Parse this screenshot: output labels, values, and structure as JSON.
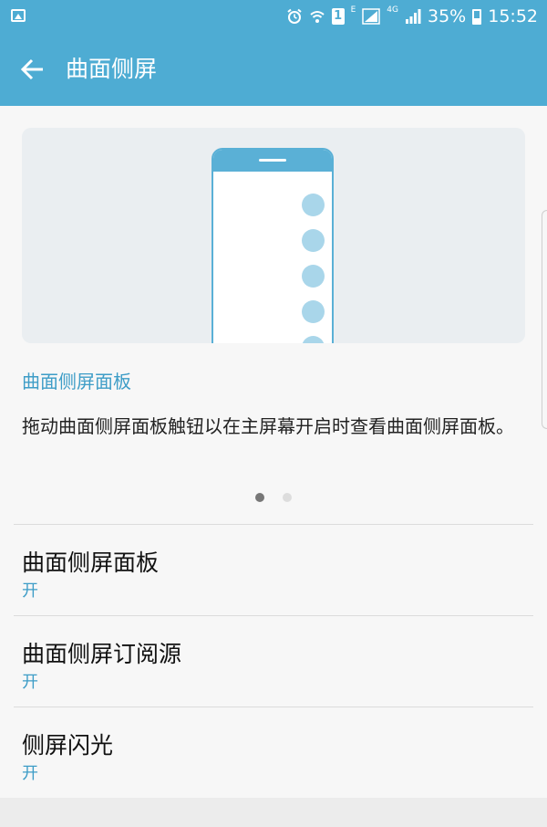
{
  "status_bar": {
    "e_label": "E",
    "fourg_label": "4G",
    "sim_label": "1",
    "battery": "35%",
    "time": "15:52"
  },
  "app_bar": {
    "title": "曲面侧屏"
  },
  "intro": {
    "section_title": "曲面侧屏面板",
    "description": "拖动曲面侧屏面板触钮以在主屏幕开启时查看曲面侧屏面板。"
  },
  "settings": [
    {
      "title": "曲面侧屏面板",
      "value": "开"
    },
    {
      "title": "曲面侧屏订阅源",
      "value": "开"
    },
    {
      "title": "侧屏闪光",
      "value": "开"
    }
  ],
  "icons": {
    "gallery": "image-icon",
    "alarm": "alarm-icon",
    "wifi": "wifi-icon",
    "signal": "signal-icon",
    "battery": "battery-icon",
    "back": "back-arrow-icon"
  },
  "colors": {
    "accent": "#4eacd3",
    "link": "#3e9dc7"
  }
}
